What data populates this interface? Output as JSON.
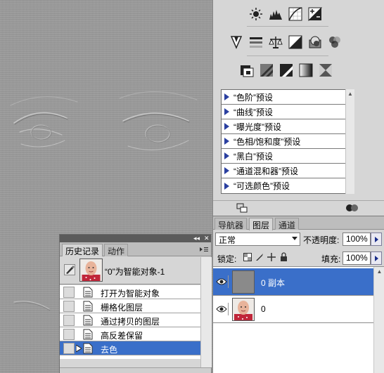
{
  "adjustments": {
    "row1_icons": [
      "brightness-contrast-icon",
      "levels-icon",
      "curves-icon",
      "exposure-icon"
    ],
    "row2_icons": [
      "vibrance-icon",
      "hue-saturation-icon",
      "color-balance-icon",
      "black-white-icon",
      "photo-filter-icon",
      "channel-mixer-icon"
    ],
    "row3_icons": [
      "invert-icon",
      "posterize-icon",
      "threshold-icon",
      "gradient-map-icon",
      "selective-color-icon"
    ],
    "presets": [
      "“色阶”预设",
      "“曲线”预设",
      "“曝光度”预设",
      "“色相/饱和度”预设",
      "“黑白”预设",
      "“通道混和器”预设",
      "“可选颜色”预设"
    ]
  },
  "layers_panel": {
    "tabs": [
      "导航器",
      "图层",
      "通道"
    ],
    "active_tab": "图层",
    "blend_mode": "正常",
    "opacity_label": "不透明度:",
    "opacity_value": "100%",
    "lock_label": "锁定:",
    "fill_label": "填充:",
    "fill_value": "100%",
    "layers": [
      {
        "name": "0 副本",
        "selected": true,
        "thumb": "gray"
      },
      {
        "name": "0",
        "selected": false,
        "thumb": "photo"
      }
    ]
  },
  "history_panel": {
    "tabs": [
      "历史记录",
      "动作"
    ],
    "active_tab": "历史记录",
    "snapshot_label": "“0”为智能对象-1",
    "items": [
      {
        "label": "打开为智能对象",
        "selected": false
      },
      {
        "label": "栅格化图层",
        "selected": false
      },
      {
        "label": "通过拷贝的图层",
        "selected": false
      },
      {
        "label": "高反差保留",
        "selected": false
      },
      {
        "label": "去色",
        "selected": true
      }
    ]
  },
  "colors": {
    "selection": "#3a6fc9",
    "panel_bg": "#d6d6d6",
    "canvas_bg": "#9c9c9c"
  }
}
